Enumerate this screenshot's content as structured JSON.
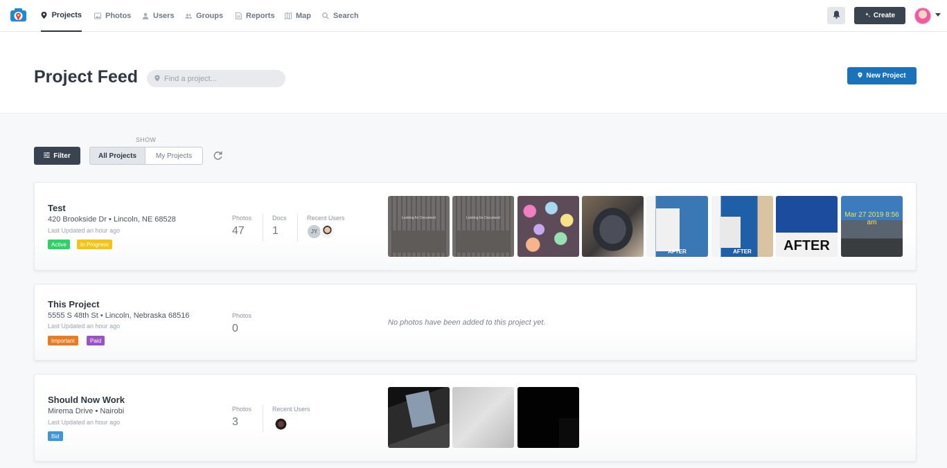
{
  "nav": {
    "items": [
      {
        "label": "Projects",
        "icon": "map-pin-icon",
        "active": true
      },
      {
        "label": "Photos",
        "icon": "photos-icon"
      },
      {
        "label": "Users",
        "icon": "user-icon"
      },
      {
        "label": "Groups",
        "icon": "groups-icon"
      },
      {
        "label": "Reports",
        "icon": "reports-icon"
      },
      {
        "label": "Map",
        "icon": "map-icon"
      },
      {
        "label": "Search",
        "icon": "search-icon"
      }
    ],
    "create_label": "Create"
  },
  "header": {
    "title": "Project Feed",
    "search_placeholder": "Find a project...",
    "new_project_label": "New Project"
  },
  "controls": {
    "show_label": "SHOW",
    "filter_label": "Filter",
    "segment": [
      "All Projects",
      "My Projects"
    ]
  },
  "projects": [
    {
      "title": "Test",
      "address": "420 Brookside Dr • Lincoln, NE 68528",
      "updated": "Last Updated an hour ago",
      "tags": [
        {
          "label": "Active",
          "color": "#2fcf6a"
        },
        {
          "label": "In Progress",
          "color": "#f2c416"
        }
      ],
      "photos_label": "Photos",
      "photos": "47",
      "docs_label": "Docs",
      "docs": "1",
      "users_label": "Recent Users",
      "user_initials": "JY",
      "thumb_captions": [
        "Looking for Document",
        "Looking for Document",
        "",
        "",
        "AFTER",
        "AFTER",
        "AFTER",
        "Mar 27 2019 8:56 am"
      ]
    },
    {
      "title": "This Project",
      "address": "5555 S 48th St • Lincoln, Nebraska 68516",
      "updated": "Last Updated an hour ago",
      "tags": [
        {
          "label": "Important",
          "color": "#ea7b22"
        },
        {
          "label": "Paid",
          "color": "#9b52c4"
        }
      ],
      "photos_label": "Photos",
      "photos": "0",
      "empty_message": "No photos have been added to this project yet."
    },
    {
      "title": "Should Now Work",
      "address": "Mirema Drive • Nairobi",
      "updated": "Last Updated an hour ago",
      "tags": [
        {
          "label": "Bid",
          "color": "#3e95d8"
        }
      ],
      "photos_label": "Photos",
      "photos": "3",
      "users_label": "Recent Users"
    }
  ]
}
